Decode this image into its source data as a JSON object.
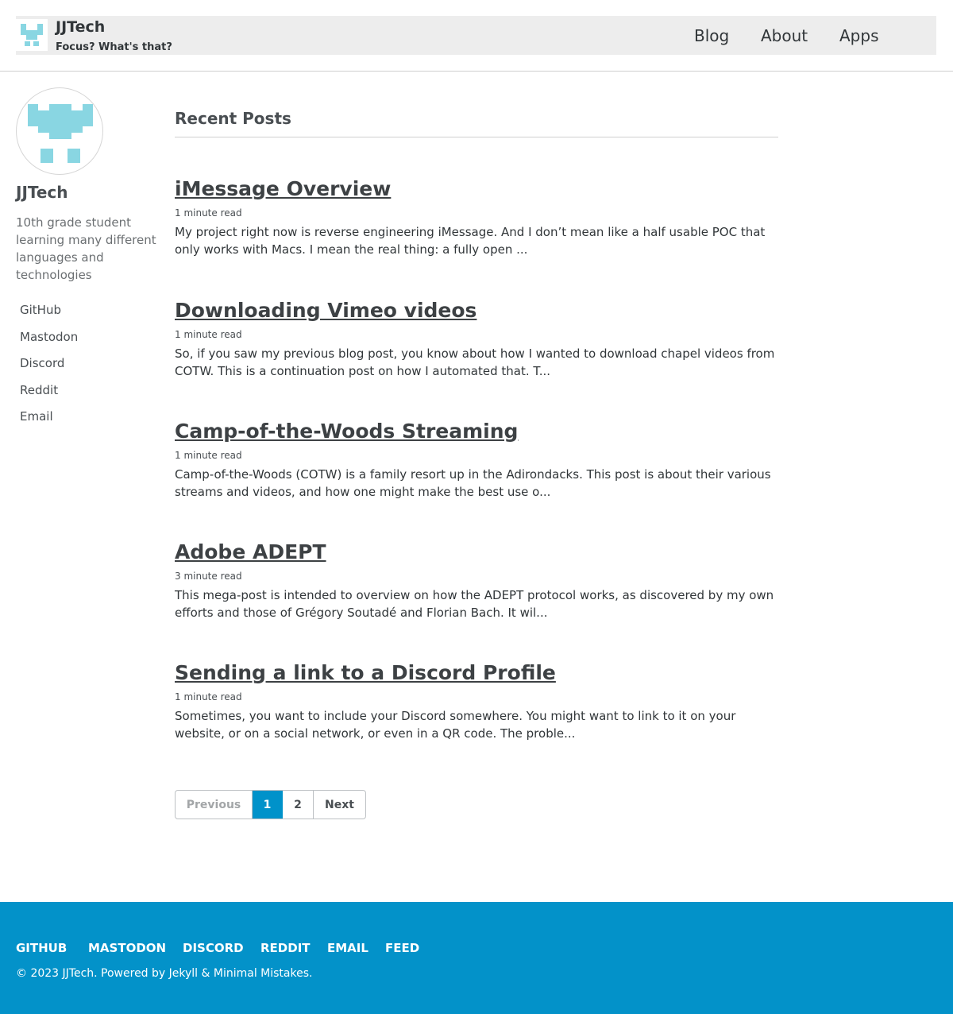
{
  "header": {
    "site_title": "JJTech",
    "site_subtitle": "Focus? What's that?",
    "nav": [
      "Blog",
      "About",
      "Apps"
    ],
    "logo_color": "#89d6e2"
  },
  "author": {
    "name": "JJTech",
    "bio": "10th grade student learning many different languages and technologies",
    "links": [
      "GitHub",
      "Mastodon",
      "Discord",
      "Reddit",
      "Email"
    ]
  },
  "main": {
    "heading": "Recent Posts",
    "posts": [
      {
        "title": "iMessage Overview",
        "meta": "1 minute read",
        "excerpt": "My project right now is reverse engineering iMessage. And I don’t mean like a half usable POC that only works with Macs. I mean the real thing: a fully open ..."
      },
      {
        "title": "Downloading Vimeo videos",
        "meta": "1 minute read",
        "excerpt": "So, if you saw my previous blog post, you know about how I wanted to download chapel videos from COTW. This is a continuation post on how I automated that. T..."
      },
      {
        "title": "Camp-of-the-Woods Streaming",
        "meta": "1 minute read",
        "excerpt": "Camp-of-the-Woods (COTW) is a family resort up in the Adirondacks. This post is about their various streams and videos, and how one might make the best use o..."
      },
      {
        "title": "Adobe ADEPT",
        "meta": "3 minute read",
        "excerpt": "This mega-post is intended to overview on how the ADEPT protocol works, as discovered by my own efforts and those of Grégory Soutadé and Florian Bach. It wil..."
      },
      {
        "title": "Sending a link to a Discord Profile",
        "meta": "1 minute read",
        "excerpt": "Sometimes, you want to include your Discord somewhere. You might want to link to it on your website, or on a social network, or even in a QR code. The proble..."
      }
    ]
  },
  "pagination": {
    "previous": "Previous",
    "pages": [
      "1",
      "2"
    ],
    "current": "1",
    "next": "Next"
  },
  "footer": {
    "links": [
      "GITHUB",
      "MASTODON",
      "DISCORD",
      "REDDIT",
      "EMAIL",
      "FEED"
    ],
    "copyright": "© 2023 JJTech. Powered by Jekyll & Minimal Mistakes."
  }
}
